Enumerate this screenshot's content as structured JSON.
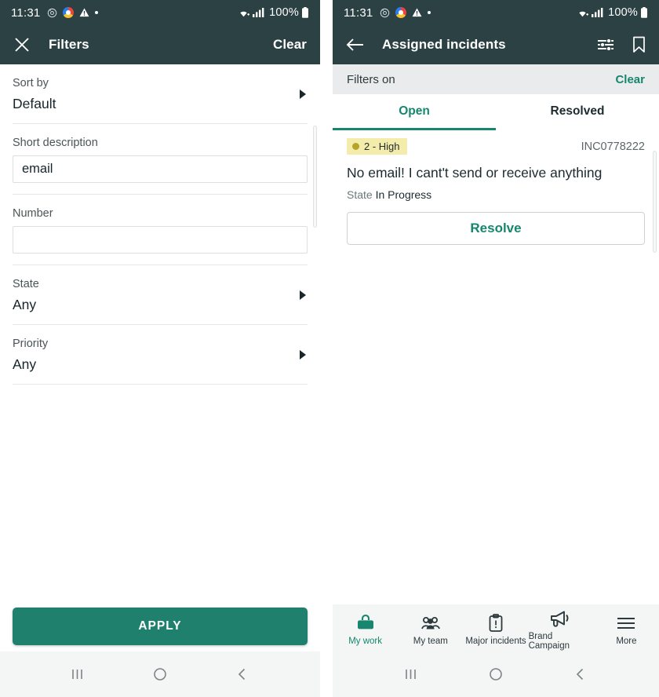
{
  "status_bar": {
    "time": "11:31",
    "left_icons": [
      "alarm-icon",
      "chrome-icon",
      "warning-icon",
      "dot-icon"
    ],
    "wifi_icon": "wifi-plus-icon",
    "signal_icon": "cellular-signal-icon",
    "battery_text": "100%",
    "battery_icon": "battery-full-icon"
  },
  "filters_screen": {
    "header": {
      "close_icon": "close-icon",
      "title": "Filters",
      "clear_label": "Clear"
    },
    "fields": [
      {
        "label": "Sort by",
        "value": "Default",
        "type": "select",
        "name": "sort-by"
      },
      {
        "label": "Short description",
        "value": "email",
        "placeholder": "",
        "type": "text",
        "name": "short-description"
      },
      {
        "label": "Number",
        "value": "",
        "placeholder": "",
        "type": "text",
        "name": "number"
      },
      {
        "label": "State",
        "value": "Any",
        "type": "select",
        "name": "state"
      },
      {
        "label": "Priority",
        "value": "Any",
        "type": "select",
        "name": "priority"
      }
    ],
    "apply_label": "APPLY"
  },
  "incidents_screen": {
    "header": {
      "back_icon": "back-arrow-icon",
      "title": "Assigned incidents",
      "filter_icon": "filter-sliders-icon",
      "bookmark_icon": "bookmark-icon"
    },
    "filters_bar": {
      "label": "Filters on",
      "clear_label": "Clear"
    },
    "tabs": [
      {
        "label": "Open",
        "active": true
      },
      {
        "label": "Resolved",
        "active": false
      }
    ],
    "incidents": [
      {
        "priority": "2 - High",
        "number": "INC0778222",
        "title": "No email! I cant't send or receive anything",
        "state_label": "State",
        "state_value": "In Progress",
        "action_label": "Resolve"
      }
    ],
    "bottom_nav": [
      {
        "label": "My work",
        "icon": "briefcase-icon",
        "active": true
      },
      {
        "label": "My team",
        "icon": "people-group-icon",
        "active": false
      },
      {
        "label": "Major incidents",
        "icon": "clipboard-alert-icon",
        "active": false
      },
      {
        "label": "Brand Campaign",
        "icon": "megaphone-icon",
        "active": false
      },
      {
        "label": "More",
        "icon": "hamburger-menu-icon",
        "active": false
      }
    ]
  },
  "android_nav": {
    "recents_icon": "recents-icon",
    "home_icon": "home-circle-icon",
    "back_icon": "back-chevron-icon"
  },
  "colors": {
    "app_bar": "#2b4144",
    "accent_green": "#16866e",
    "apply_green": "#1f806e",
    "priority_badge_bg": "#f3ecab",
    "priority_dot": "#b6a42a"
  }
}
